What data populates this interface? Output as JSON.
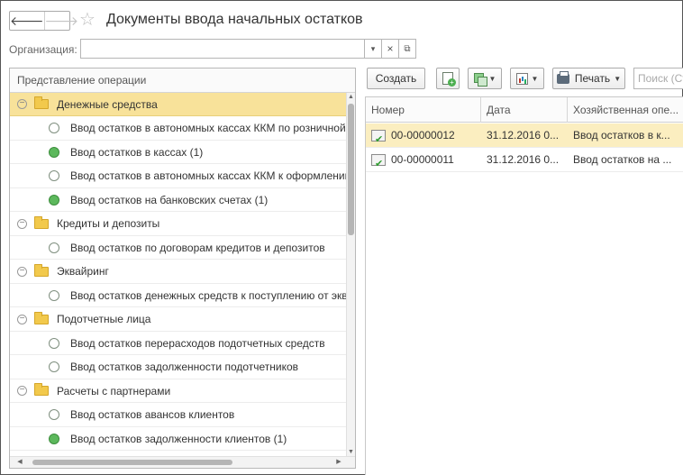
{
  "header": {
    "title": "Документы ввода начальных остатков",
    "back_glyph": "🡐",
    "forward_glyph": "🡒",
    "star_glyph": "☆"
  },
  "filter": {
    "org_label": "Организация:",
    "org_value": "",
    "drop_glyph": "▾",
    "clear_glyph": "×",
    "open_glyph": "⧉"
  },
  "tree": {
    "header": "Представление операции",
    "rows": [
      {
        "kind": "group",
        "label": "Денежные средства",
        "selected": true
      },
      {
        "kind": "item",
        "label": "Ввод остатков в автономных кассах ККМ по розничной",
        "filled": false
      },
      {
        "kind": "item",
        "label": "Ввод остатков в кассах (1)",
        "filled": true
      },
      {
        "kind": "item",
        "label": "Ввод остатков в автономных кассах ККМ к оформлению",
        "filled": false
      },
      {
        "kind": "item",
        "label": "Ввод остатков на банковских счетах (1)",
        "filled": true
      },
      {
        "kind": "group",
        "label": "Кредиты и депозиты",
        "selected": false
      },
      {
        "kind": "item",
        "label": "Ввод остатков по договорам кредитов и депозитов",
        "filled": false
      },
      {
        "kind": "group",
        "label": "Эквайринг",
        "selected": false
      },
      {
        "kind": "item",
        "label": "Ввод остатков денежных средств к поступлению от экв",
        "filled": false
      },
      {
        "kind": "group",
        "label": "Подотчетные лица",
        "selected": false
      },
      {
        "kind": "item",
        "label": "Ввод остатков перерасходов подотчетных средств",
        "filled": false
      },
      {
        "kind": "item",
        "label": "Ввод остатков задолженности подотчетников",
        "filled": false
      },
      {
        "kind": "group",
        "label": "Расчеты с партнерами",
        "selected": false
      },
      {
        "kind": "item",
        "label": "Ввод остатков авансов клиентов",
        "filled": false
      },
      {
        "kind": "item",
        "label": "Ввод остатков задолженности клиентов (1)",
        "filled": true
      }
    ]
  },
  "toolbar": {
    "create_label": "Создать",
    "print_label": "Печать",
    "search_placeholder": "Поиск (Ct"
  },
  "grid": {
    "columns": [
      "Номер",
      "Дата",
      "Хозяйственная опе..."
    ],
    "rows": [
      {
        "number": "00-00000012",
        "date": "31.12.2016 0...",
        "operation": "Ввод остатков в к...",
        "selected": true
      },
      {
        "number": "00-00000011",
        "date": "31.12.2016 0...",
        "operation": "Ввод остатков на ...",
        "selected": false
      }
    ]
  },
  "colors": {
    "selection": "#f8e29a",
    "grid_selection": "#fbeec0",
    "status_green": "#5cb85c",
    "folder": "#f2c94c"
  }
}
